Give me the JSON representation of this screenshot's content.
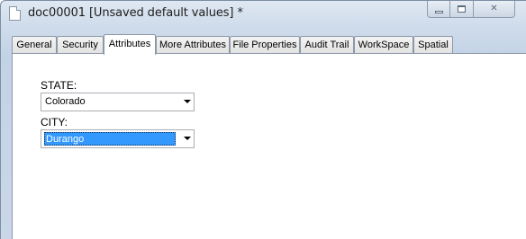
{
  "window": {
    "title": "doc00001 [Unsaved default values] *",
    "icon": "document-icon"
  },
  "caption_buttons": {
    "minimize": "minimize-icon",
    "maximize": "maximize-icon",
    "close": "close-icon"
  },
  "tabs": [
    {
      "label": "General"
    },
    {
      "label": "Security"
    },
    {
      "label": "Attributes",
      "active": true
    },
    {
      "label": "More Attributes"
    },
    {
      "label": "File Properties"
    },
    {
      "label": "Audit Trail"
    },
    {
      "label": "WorkSpace"
    },
    {
      "label": "Spatial"
    }
  ],
  "fields": {
    "state": {
      "label": "STATE:",
      "value": "Colorado"
    },
    "city": {
      "label": "CITY:",
      "value": "Durango",
      "selected": true
    }
  },
  "colors": {
    "selection": "#3399ff",
    "tab_border": "#8c98a8"
  }
}
